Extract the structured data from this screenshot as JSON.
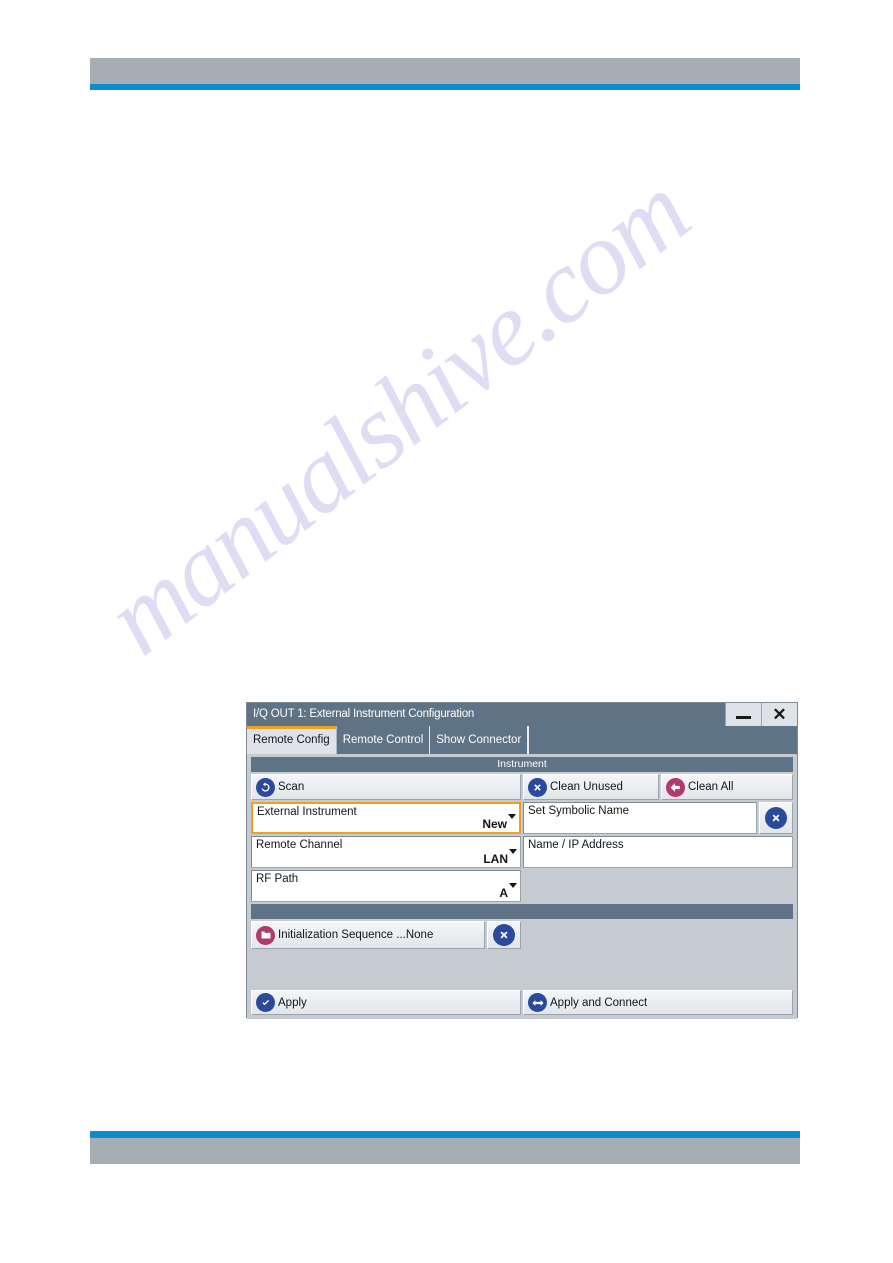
{
  "page": {
    "watermark_text": "manualshive.com",
    "accent_rule_color": "#0b8ccd",
    "bar_color": "#a6adb4"
  },
  "dialog": {
    "title": "I/Q OUT 1: External Instrument Configuration",
    "window_controls": {
      "minimize_label": "Minimize",
      "close_label": "Close",
      "close_glyph": "✕"
    },
    "tabs": [
      {
        "label": "Remote Config",
        "active": true
      },
      {
        "label": "Remote Control",
        "active": false
      },
      {
        "label": "Show Connector",
        "active": false
      }
    ],
    "sections": {
      "instrument_header": "Instrument",
      "second_header": ""
    },
    "actions": {
      "scan": "Scan",
      "clean_unused": "Clean Unused",
      "clean_all": "Clean All",
      "apply": "Apply",
      "apply_and_connect": "Apply and Connect"
    },
    "fields": {
      "external_instrument": {
        "label": "External Instrument",
        "value": "New"
      },
      "set_symbolic_name": {
        "label": "Set Symbolic Name",
        "value": ""
      },
      "remote_channel": {
        "label": "Remote Channel",
        "value": "LAN"
      },
      "name_ip_address": {
        "label": "Name / IP Address",
        "value": ""
      },
      "rf_path": {
        "label": "RF Path",
        "value": "A"
      },
      "initialization_sequence": {
        "label": "Initialization Sequence ...",
        "value": "None"
      }
    },
    "colors": {
      "titlebar": "#5e7385",
      "panel": "#c5cbd1",
      "focus_outline": "#f0a020",
      "icon_blue": "#2b4a9b",
      "icon_magenta": "#b03a6e"
    }
  }
}
